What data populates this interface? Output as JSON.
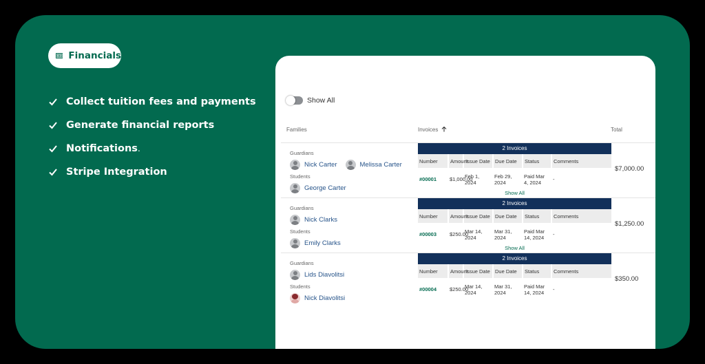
{
  "badge": {
    "label": "Financials",
    "icon": "money-bill-icon"
  },
  "features": [
    {
      "text": "Collect tuition fees and payments",
      "suffix": ""
    },
    {
      "text": "Generate financial reports",
      "suffix": ""
    },
    {
      "text": "Notifications",
      "suffix": "."
    },
    {
      "text": "Stripe Integration",
      "suffix": ""
    }
  ],
  "panel": {
    "toggle_label": "Show All",
    "columns": {
      "families": "Families",
      "invoices": "Invoices",
      "total": "Total"
    },
    "sub_labels": {
      "guardians": "Guardians",
      "students": "Students"
    },
    "invoice_columns": [
      "Number",
      "Amount",
      "Issue Date",
      "Due Date",
      "Status",
      "Comments"
    ],
    "rows": [
      {
        "guardians": [
          "Nick Carter",
          "Melissa Carter"
        ],
        "students": [
          "George Carter"
        ],
        "invoice_count": "2 Invoices",
        "invoice": {
          "number": "#00001",
          "amount": "$1,000.00",
          "issue_date": "Feb 1, 2024",
          "due_date": "Feb 29, 2024",
          "status": "Paid Mar 4, 2024",
          "comments": "-"
        },
        "show_all": "Show All",
        "total": "$7,000.00"
      },
      {
        "guardians": [
          "Nick Clarks"
        ],
        "students": [
          "Emily Clarks"
        ],
        "invoice_count": "2 Invoices",
        "invoice": {
          "number": "#00003",
          "amount": "$250.00",
          "issue_date": "Mar 14, 2024",
          "due_date": "Mar 31, 2024",
          "status": "Paid Mar 14, 2024",
          "comments": "-"
        },
        "show_all": "Show All",
        "total": "$1,250.00"
      },
      {
        "guardians": [
          "Lids Diavolitsi"
        ],
        "students": [
          "Nick Diavolitsi"
        ],
        "invoice_count": "2 Invoices",
        "invoice": {
          "number": "#00004",
          "amount": "$250.00",
          "issue_date": "Mar 14, 2024",
          "due_date": "Mar 31, 2024",
          "status": "Paid Mar 14, 2024",
          "comments": "-"
        },
        "show_all": "",
        "total": "$350.00"
      }
    ]
  },
  "colors": {
    "brand_green": "#026a4f",
    "navy": "#12305a",
    "link_blue": "#27548a"
  }
}
